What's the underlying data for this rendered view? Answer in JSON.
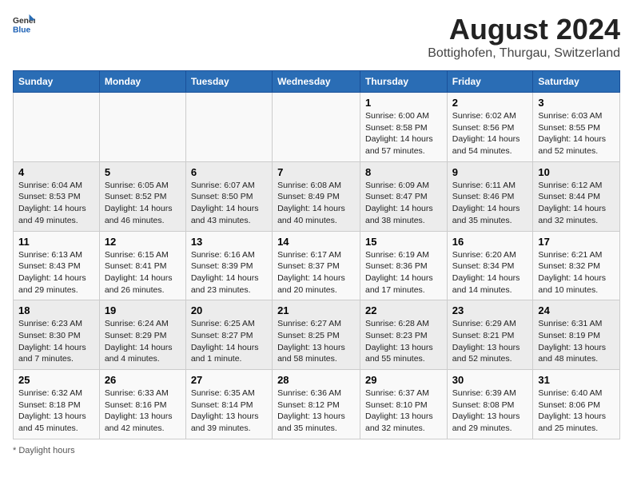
{
  "logo": {
    "general": "General",
    "blue": "Blue"
  },
  "title": "August 2024",
  "subtitle": "Bottighofen, Thurgau, Switzerland",
  "days_of_week": [
    "Sunday",
    "Monday",
    "Tuesday",
    "Wednesday",
    "Thursday",
    "Friday",
    "Saturday"
  ],
  "footer": "Daylight hours",
  "weeks": [
    [
      {
        "day": "",
        "info": ""
      },
      {
        "day": "",
        "info": ""
      },
      {
        "day": "",
        "info": ""
      },
      {
        "day": "",
        "info": ""
      },
      {
        "day": "1",
        "info": "Sunrise: 6:00 AM\nSunset: 8:58 PM\nDaylight: 14 hours and 57 minutes."
      },
      {
        "day": "2",
        "info": "Sunrise: 6:02 AM\nSunset: 8:56 PM\nDaylight: 14 hours and 54 minutes."
      },
      {
        "day": "3",
        "info": "Sunrise: 6:03 AM\nSunset: 8:55 PM\nDaylight: 14 hours and 52 minutes."
      }
    ],
    [
      {
        "day": "4",
        "info": "Sunrise: 6:04 AM\nSunset: 8:53 PM\nDaylight: 14 hours and 49 minutes."
      },
      {
        "day": "5",
        "info": "Sunrise: 6:05 AM\nSunset: 8:52 PM\nDaylight: 14 hours and 46 minutes."
      },
      {
        "day": "6",
        "info": "Sunrise: 6:07 AM\nSunset: 8:50 PM\nDaylight: 14 hours and 43 minutes."
      },
      {
        "day": "7",
        "info": "Sunrise: 6:08 AM\nSunset: 8:49 PM\nDaylight: 14 hours and 40 minutes."
      },
      {
        "day": "8",
        "info": "Sunrise: 6:09 AM\nSunset: 8:47 PM\nDaylight: 14 hours and 38 minutes."
      },
      {
        "day": "9",
        "info": "Sunrise: 6:11 AM\nSunset: 8:46 PM\nDaylight: 14 hours and 35 minutes."
      },
      {
        "day": "10",
        "info": "Sunrise: 6:12 AM\nSunset: 8:44 PM\nDaylight: 14 hours and 32 minutes."
      }
    ],
    [
      {
        "day": "11",
        "info": "Sunrise: 6:13 AM\nSunset: 8:43 PM\nDaylight: 14 hours and 29 minutes."
      },
      {
        "day": "12",
        "info": "Sunrise: 6:15 AM\nSunset: 8:41 PM\nDaylight: 14 hours and 26 minutes."
      },
      {
        "day": "13",
        "info": "Sunrise: 6:16 AM\nSunset: 8:39 PM\nDaylight: 14 hours and 23 minutes."
      },
      {
        "day": "14",
        "info": "Sunrise: 6:17 AM\nSunset: 8:37 PM\nDaylight: 14 hours and 20 minutes."
      },
      {
        "day": "15",
        "info": "Sunrise: 6:19 AM\nSunset: 8:36 PM\nDaylight: 14 hours and 17 minutes."
      },
      {
        "day": "16",
        "info": "Sunrise: 6:20 AM\nSunset: 8:34 PM\nDaylight: 14 hours and 14 minutes."
      },
      {
        "day": "17",
        "info": "Sunrise: 6:21 AM\nSunset: 8:32 PM\nDaylight: 14 hours and 10 minutes."
      }
    ],
    [
      {
        "day": "18",
        "info": "Sunrise: 6:23 AM\nSunset: 8:30 PM\nDaylight: 14 hours and 7 minutes."
      },
      {
        "day": "19",
        "info": "Sunrise: 6:24 AM\nSunset: 8:29 PM\nDaylight: 14 hours and 4 minutes."
      },
      {
        "day": "20",
        "info": "Sunrise: 6:25 AM\nSunset: 8:27 PM\nDaylight: 14 hours and 1 minute."
      },
      {
        "day": "21",
        "info": "Sunrise: 6:27 AM\nSunset: 8:25 PM\nDaylight: 13 hours and 58 minutes."
      },
      {
        "day": "22",
        "info": "Sunrise: 6:28 AM\nSunset: 8:23 PM\nDaylight: 13 hours and 55 minutes."
      },
      {
        "day": "23",
        "info": "Sunrise: 6:29 AM\nSunset: 8:21 PM\nDaylight: 13 hours and 52 minutes."
      },
      {
        "day": "24",
        "info": "Sunrise: 6:31 AM\nSunset: 8:19 PM\nDaylight: 13 hours and 48 minutes."
      }
    ],
    [
      {
        "day": "25",
        "info": "Sunrise: 6:32 AM\nSunset: 8:18 PM\nDaylight: 13 hours and 45 minutes."
      },
      {
        "day": "26",
        "info": "Sunrise: 6:33 AM\nSunset: 8:16 PM\nDaylight: 13 hours and 42 minutes."
      },
      {
        "day": "27",
        "info": "Sunrise: 6:35 AM\nSunset: 8:14 PM\nDaylight: 13 hours and 39 minutes."
      },
      {
        "day": "28",
        "info": "Sunrise: 6:36 AM\nSunset: 8:12 PM\nDaylight: 13 hours and 35 minutes."
      },
      {
        "day": "29",
        "info": "Sunrise: 6:37 AM\nSunset: 8:10 PM\nDaylight: 13 hours and 32 minutes."
      },
      {
        "day": "30",
        "info": "Sunrise: 6:39 AM\nSunset: 8:08 PM\nDaylight: 13 hours and 29 minutes."
      },
      {
        "day": "31",
        "info": "Sunrise: 6:40 AM\nSunset: 8:06 PM\nDaylight: 13 hours and 25 minutes."
      }
    ]
  ]
}
